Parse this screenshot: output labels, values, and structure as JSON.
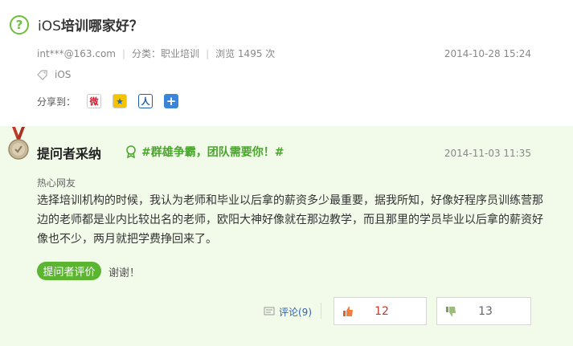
{
  "question": {
    "title_prefix": "iOS",
    "title_rest": "培训哪家好？",
    "asker": "int***@163.com",
    "category": "分类：职业培训",
    "views": "浏览 1495 次",
    "date": "2014-10-28 15:24",
    "tag": "iOS",
    "share_label": "分享到：",
    "share_buttons": [
      "weibo-share",
      "qzone-share",
      "renren-share",
      "more-share"
    ]
  },
  "answer": {
    "accepted_label": "提问者采纳",
    "slogan": "#群雄争霸，团队需要你！#",
    "date": "2014-11-03 11:35",
    "answerer": "热心网友",
    "body": "选择培训机构的时候，我认为老师和毕业以后拿的薪资多少最重要，据我所知，好像好程序员训练营那边的老师都是业内比较出名的老师，欧阳大神好像就在那边教学，而且那里的学员毕业以后拿的薪资好像也不少，两月就把学费挣回来了。",
    "evaluation_label": "提问者评价",
    "evaluation_text": "谢谢！",
    "comment_label": "评论(9)",
    "upvotes": "12",
    "downvotes": "13"
  },
  "colors": {
    "accent_green": "#5cb531",
    "panel_bg": "#f2fbea",
    "link_blue": "#2d64b3",
    "upvote_red": "#c0392b"
  }
}
